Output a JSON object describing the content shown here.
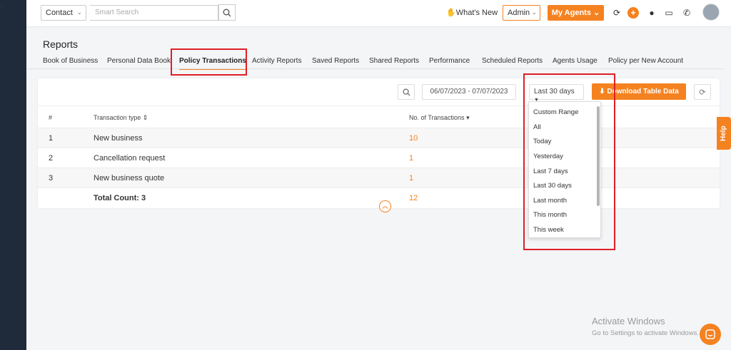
{
  "topbar": {
    "contact_select": "Contact",
    "search_placeholder": "Smart Search",
    "whats_new": "What's New",
    "admin_select": "Admin",
    "my_agents": "My Agents"
  },
  "page": {
    "title": "Reports"
  },
  "tabs": [
    {
      "label": "Book of Business"
    },
    {
      "label": "Personal Data Book"
    },
    {
      "label": "Policy Transactions"
    },
    {
      "label": "Activity Reports"
    },
    {
      "label": "Saved Reports"
    },
    {
      "label": "Shared Reports"
    },
    {
      "label": "Performance"
    },
    {
      "label": "Scheduled Reports"
    },
    {
      "label": "Agents Usage"
    },
    {
      "label": "Policy per New Account"
    }
  ],
  "toolbar": {
    "date_range": "06/07/2023 - 07/07/2023",
    "range_select": "Last 30 days",
    "download_label": "Download Table Data"
  },
  "table": {
    "headers": [
      "#",
      "Transaction type",
      "No. of Transactions"
    ],
    "rows": [
      {
        "index": "1",
        "type": "New business",
        "count": "10"
      },
      {
        "index": "2",
        "type": "Cancellation request",
        "count": "1"
      },
      {
        "index": "3",
        "type": "New business quote",
        "count": "1"
      }
    ],
    "total_label": "Total Count: 3",
    "total_value": "12"
  },
  "range_options": [
    "Custom Range",
    "All",
    "Today",
    "Yesterday",
    "Last 7 days",
    "Last 30 days",
    "Last month",
    "This month",
    "This week"
  ],
  "help_label": "Help",
  "watermark": {
    "title": "Activate Windows",
    "subtitle": "Go to Settings to activate Windows."
  },
  "colors": {
    "accent": "#f58220",
    "sidebar": "#1f2b3a",
    "highlight": "#e01e26"
  }
}
